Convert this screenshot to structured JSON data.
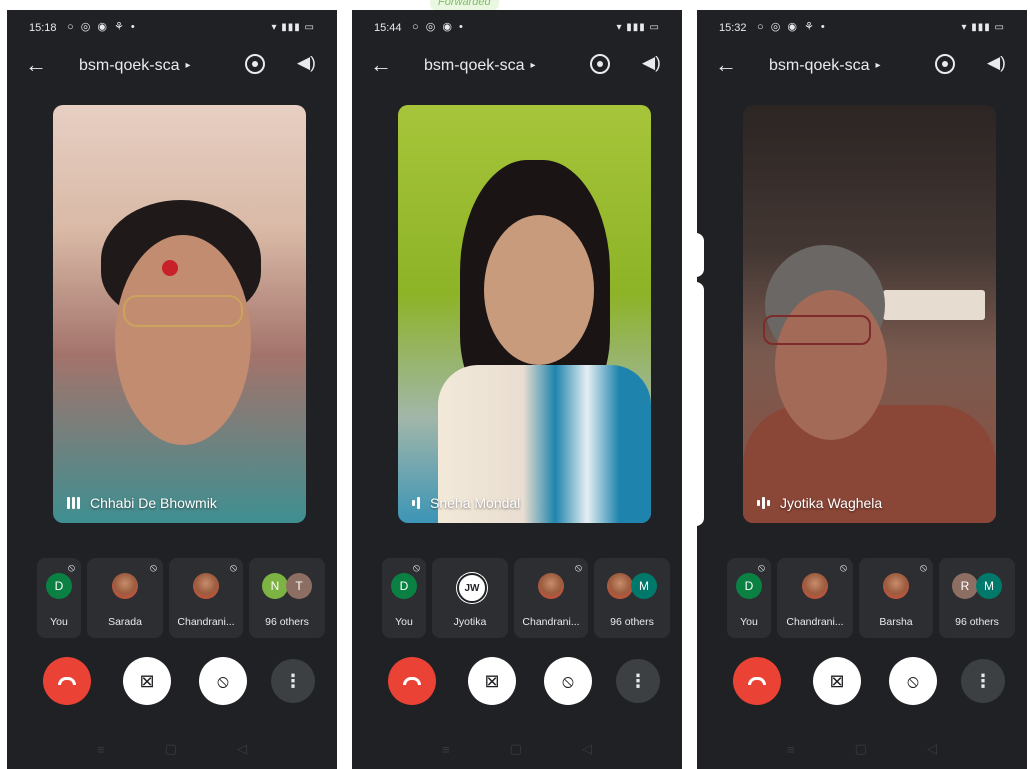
{
  "forwarded_label": "Forwarded",
  "meeting_title": "bsm-qoek-sca",
  "phones": [
    {
      "status_time": "15:18",
      "speaker_name": "Chhabi De Bhowmik",
      "tiles": [
        {
          "initial": "D",
          "color": "#0b8043",
          "label": "You"
        },
        {
          "initial": "",
          "color": "",
          "label": "Sarada"
        },
        {
          "initial": "",
          "color": "",
          "label": "Chandrani..."
        },
        {
          "initials": [
            "N",
            "T"
          ],
          "colors": [
            "#7cb342",
            "#8d6e63"
          ],
          "label": "96 others"
        }
      ]
    },
    {
      "status_time": "15:44",
      "speaker_name": "Sneha Mondal",
      "tiles": [
        {
          "initial": "D",
          "color": "#0b8043",
          "label": "You"
        },
        {
          "initial": "JW",
          "color": "#ffffff",
          "label": "Jyotika"
        },
        {
          "initial": "",
          "color": "",
          "label": "Chandrani..."
        },
        {
          "initials": [
            "",
            "M"
          ],
          "colors": [
            "",
            "#00796b"
          ],
          "label": "96 others"
        }
      ]
    },
    {
      "status_time": "15:32",
      "speaker_name": "Jyotika Waghela",
      "tiles": [
        {
          "initial": "D",
          "color": "#0b8043",
          "label": "You"
        },
        {
          "initial": "",
          "color": "",
          "label": "Chandrani..."
        },
        {
          "initial": "",
          "color": "",
          "label": "Barsha"
        },
        {
          "initials": [
            "R",
            "M"
          ],
          "colors": [
            "#8d6e63",
            "#00796b"
          ],
          "label": "96 others"
        }
      ]
    }
  ],
  "icons": {
    "back": "←",
    "caret": "▸",
    "speaker": "🔊",
    "mic_off": "⦸",
    "more": "⋮",
    "cam_off": "▭",
    "nav_menu": "≡",
    "nav_home": "▢",
    "nav_back": "◁"
  },
  "colors": {
    "background": "#202124",
    "end_call": "#ea4335",
    "tile": "#2d2e31"
  }
}
